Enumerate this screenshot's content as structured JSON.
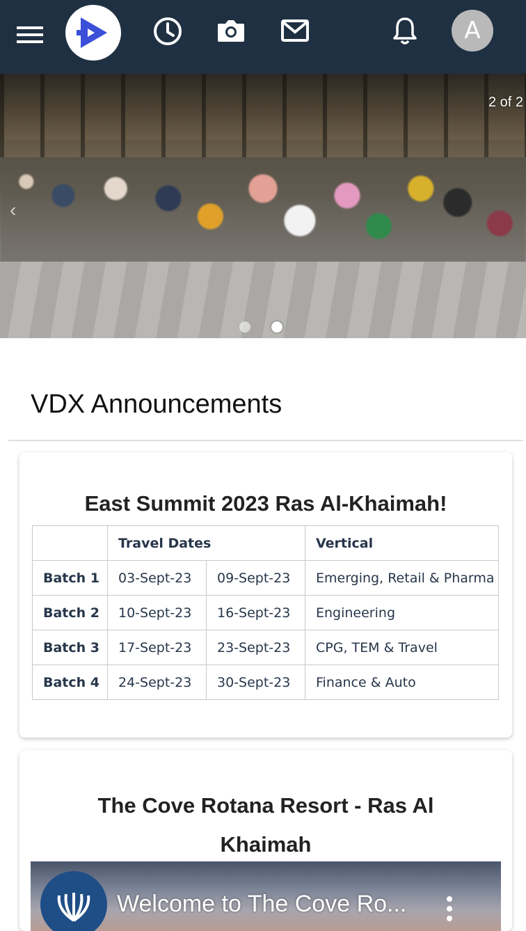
{
  "header": {
    "icons": [
      "menu-icon",
      "app-logo",
      "clock-icon",
      "camera-icon",
      "mail-icon",
      "bell-icon"
    ],
    "avatar_initial": "A",
    "colors": {
      "bar": "#1f3042",
      "logo_accent": "#3b4fd8"
    }
  },
  "carousel": {
    "slide_indicator": "2 of 2",
    "active_index": 2,
    "total": 2
  },
  "announcements": {
    "section_title": "VDX Announcements",
    "cards": [
      {
        "title": "East Summit 2023 Ras Al-Khaimah!",
        "table": {
          "headers": [
            "",
            "Travel Dates",
            "Vertical"
          ],
          "rows": [
            {
              "batch": "Batch 1",
              "start": "03-Sept-23",
              "end": "09-Sept-23",
              "vertical": "Emerging, Retail & Pharma"
            },
            {
              "batch": "Batch 2",
              "start": "10-Sept-23",
              "end": "16-Sept-23",
              "vertical": "Engineering"
            },
            {
              "batch": "Batch 3",
              "start": "17-Sept-23",
              "end": "23-Sept-23",
              "vertical": "CPG, TEM & Travel"
            },
            {
              "batch": "Batch 4",
              "start": "24-Sept-23",
              "end": "30-Sept-23",
              "vertical": "Finance & Auto"
            }
          ]
        }
      },
      {
        "title": "The Cove Rotana Resort - Ras Al Khaimah",
        "video_title": "Welcome to The Cove Ro..."
      }
    ]
  }
}
